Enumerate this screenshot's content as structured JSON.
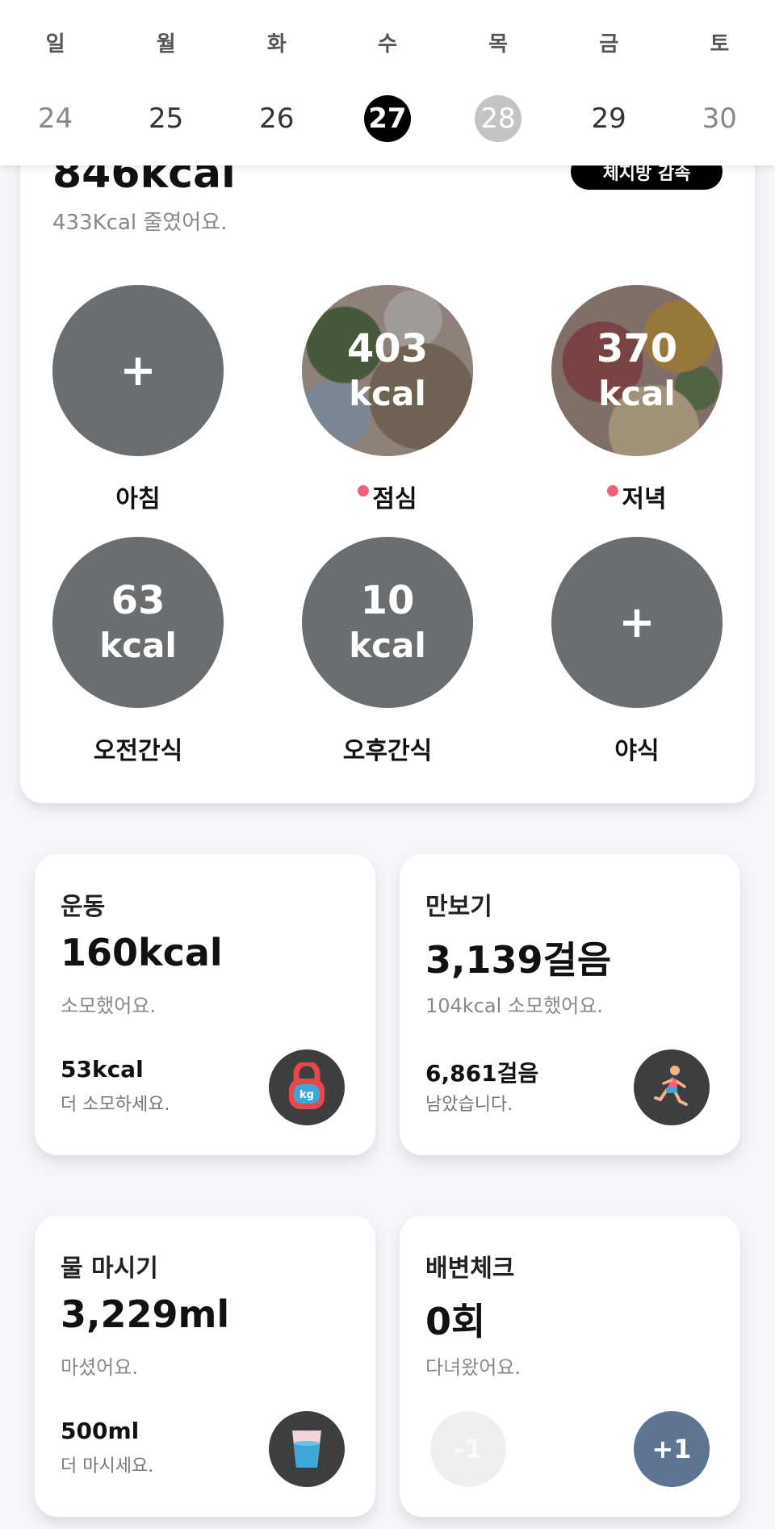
{
  "week": {
    "days": [
      {
        "name": "일",
        "date": "24",
        "state": "muted"
      },
      {
        "name": "월",
        "date": "25",
        "state": "normal"
      },
      {
        "name": "화",
        "date": "26",
        "state": "normal"
      },
      {
        "name": "수",
        "date": "27",
        "state": "selected"
      },
      {
        "name": "목",
        "date": "28",
        "state": "today"
      },
      {
        "name": "금",
        "date": "29",
        "state": "normal"
      },
      {
        "name": "토",
        "date": "30",
        "state": "muted"
      }
    ]
  },
  "meals_card": {
    "total_kcal": "846kcal",
    "reduced_text": "433Kcal 줄였어요.",
    "button_label": "체지방 감속",
    "meals": [
      {
        "label": "아침",
        "kcal": "",
        "unit": "",
        "plus": "+",
        "has_photo": false,
        "dot": false
      },
      {
        "label": "점심",
        "kcal": "403",
        "unit": "kcal",
        "plus": "",
        "has_photo": true,
        "dot": true
      },
      {
        "label": "저녁",
        "kcal": "370",
        "unit": "kcal",
        "plus": "",
        "has_photo": true,
        "dot": true
      },
      {
        "label": "오전간식",
        "kcal": "63",
        "unit": "kcal",
        "plus": "",
        "has_photo": false,
        "dot": false
      },
      {
        "label": "오후간식",
        "kcal": "10",
        "unit": "kcal",
        "plus": "",
        "has_photo": false,
        "dot": false
      },
      {
        "label": "야식",
        "kcal": "",
        "unit": "",
        "plus": "+",
        "has_photo": false,
        "dot": false
      }
    ]
  },
  "exercise": {
    "title": "운동",
    "value": "160kcal",
    "sub": "소모했어요.",
    "remain": "53kcal",
    "remain_sub": "더 소모하세요.",
    "icon": "kettlebell-icon"
  },
  "steps": {
    "title": "만보기",
    "value": "3,139걸음",
    "sub": "104kcal 소모했어요.",
    "remain": "6,861걸음",
    "remain_sub": "남았습니다.",
    "icon": "runner-icon"
  },
  "water": {
    "title": "물 마시기",
    "value": "3,229ml",
    "sub": "마셨어요.",
    "remain": "500ml",
    "remain_sub": "더 마시세요.",
    "icon": "water-cup-icon"
  },
  "bowel": {
    "title": "배변체크",
    "value": "0회",
    "sub": "다녀왔어요.",
    "minus_label": "-1",
    "plus_label": "+1"
  },
  "colors": {
    "circle": "#6b6e70",
    "dot": "#f0607a",
    "plus_button": "#5d7590",
    "kettlebell_red": "#e8484a",
    "kettlebell_blue": "#3fa6d8"
  }
}
